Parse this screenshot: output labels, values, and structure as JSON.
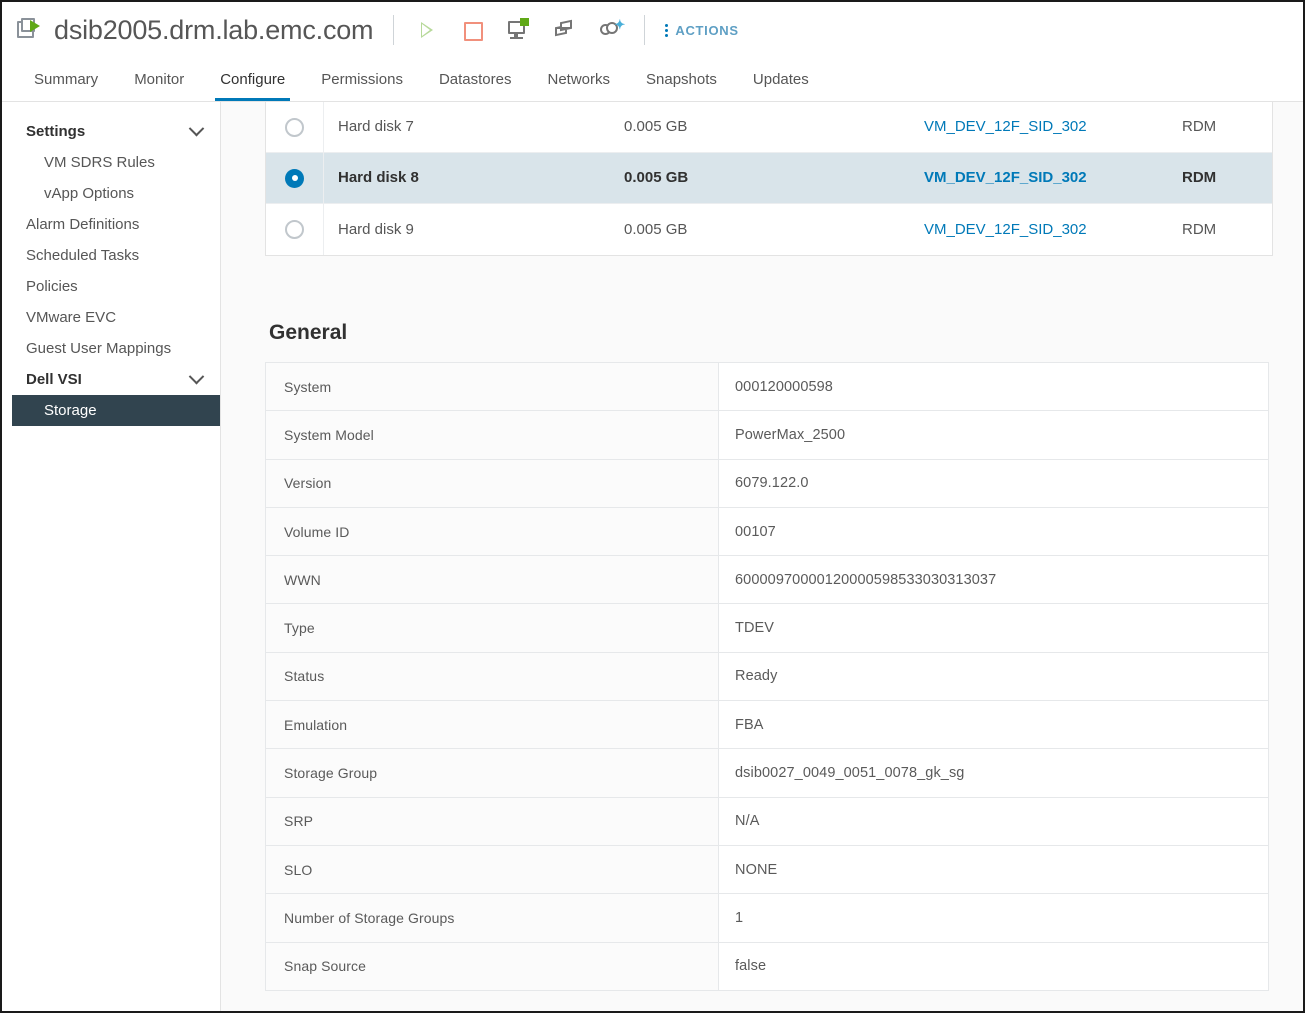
{
  "header": {
    "vm_name": "dsib2005.drm.lab.emc.com",
    "vm_icon": "powered-on-vm-icon",
    "toolbar_icons": [
      {
        "name": "power-on-icon",
        "glyph": "play-triangle"
      },
      {
        "name": "power-off-icon",
        "glyph": "stop-square"
      },
      {
        "name": "launch-console-icon",
        "glyph": "monitor"
      },
      {
        "name": "migrate-icon",
        "glyph": "stacked-boxes"
      },
      {
        "name": "snapshot-icon",
        "glyph": "clock-sparkle"
      }
    ],
    "actions_label": "ACTIONS"
  },
  "tabs": [
    {
      "label": "Summary",
      "active": false
    },
    {
      "label": "Monitor",
      "active": false
    },
    {
      "label": "Configure",
      "active": true
    },
    {
      "label": "Permissions",
      "active": false
    },
    {
      "label": "Datastores",
      "active": false
    },
    {
      "label": "Networks",
      "active": false
    },
    {
      "label": "Snapshots",
      "active": false
    },
    {
      "label": "Updates",
      "active": false
    }
  ],
  "sidebar": {
    "items": [
      {
        "label": "Settings",
        "type": "group",
        "expanded": true,
        "selected": false
      },
      {
        "label": "VM SDRS Rules",
        "type": "sub",
        "selected": false
      },
      {
        "label": "vApp Options",
        "type": "sub",
        "selected": false
      },
      {
        "label": "Alarm Definitions",
        "type": "item",
        "selected": false
      },
      {
        "label": "Scheduled Tasks",
        "type": "item",
        "selected": false
      },
      {
        "label": "Policies",
        "type": "item",
        "selected": false
      },
      {
        "label": "VMware EVC",
        "type": "item",
        "selected": false
      },
      {
        "label": "Guest User Mappings",
        "type": "item",
        "selected": false
      },
      {
        "label": "Dell VSI",
        "type": "group",
        "expanded": true,
        "selected": false
      },
      {
        "label": "Storage",
        "type": "item",
        "selected": true
      }
    ]
  },
  "disk_table": {
    "rows": [
      {
        "name": "Hard disk 7",
        "size": "0.005 GB",
        "link": "VM_DEV_12F_SID_302",
        "type": "RDM",
        "selected": false
      },
      {
        "name": "Hard disk 8",
        "size": "0.005 GB",
        "link": "VM_DEV_12F_SID_302",
        "type": "RDM",
        "selected": true
      },
      {
        "name": "Hard disk 9",
        "size": "0.005 GB",
        "link": "VM_DEV_12F_SID_302",
        "type": "RDM",
        "selected": false
      }
    ]
  },
  "general": {
    "title": "General",
    "rows": [
      {
        "label": "System",
        "value": "000120000598"
      },
      {
        "label": "System Model",
        "value": "PowerMax_2500"
      },
      {
        "label": "Version",
        "value": "6079.122.0"
      },
      {
        "label": "Volume ID",
        "value": "00107"
      },
      {
        "label": "WWN",
        "value": "60000970000120000598533030313037"
      },
      {
        "label": "Type",
        "value": "TDEV"
      },
      {
        "label": "Status",
        "value": "Ready"
      },
      {
        "label": "Emulation",
        "value": "FBA"
      },
      {
        "label": "Storage Group",
        "value": "dsib0027_0049_0051_0078_gk_sg"
      },
      {
        "label": "SRP",
        "value": "N/A"
      },
      {
        "label": "SLO",
        "value": "NONE"
      },
      {
        "label": "Number of Storage Groups",
        "value": "1"
      },
      {
        "label": "Snap Source",
        "value": "false"
      }
    ]
  },
  "colors": {
    "accent_blue": "#0079b8",
    "link_blue": "#0079b8",
    "selected_row_bg": "#d9e4ea",
    "selected_nav_bg": "#31444f",
    "power_on_green": "#60a917",
    "power_off_red": "#f1907c",
    "page_bg": "#fafafa"
  }
}
